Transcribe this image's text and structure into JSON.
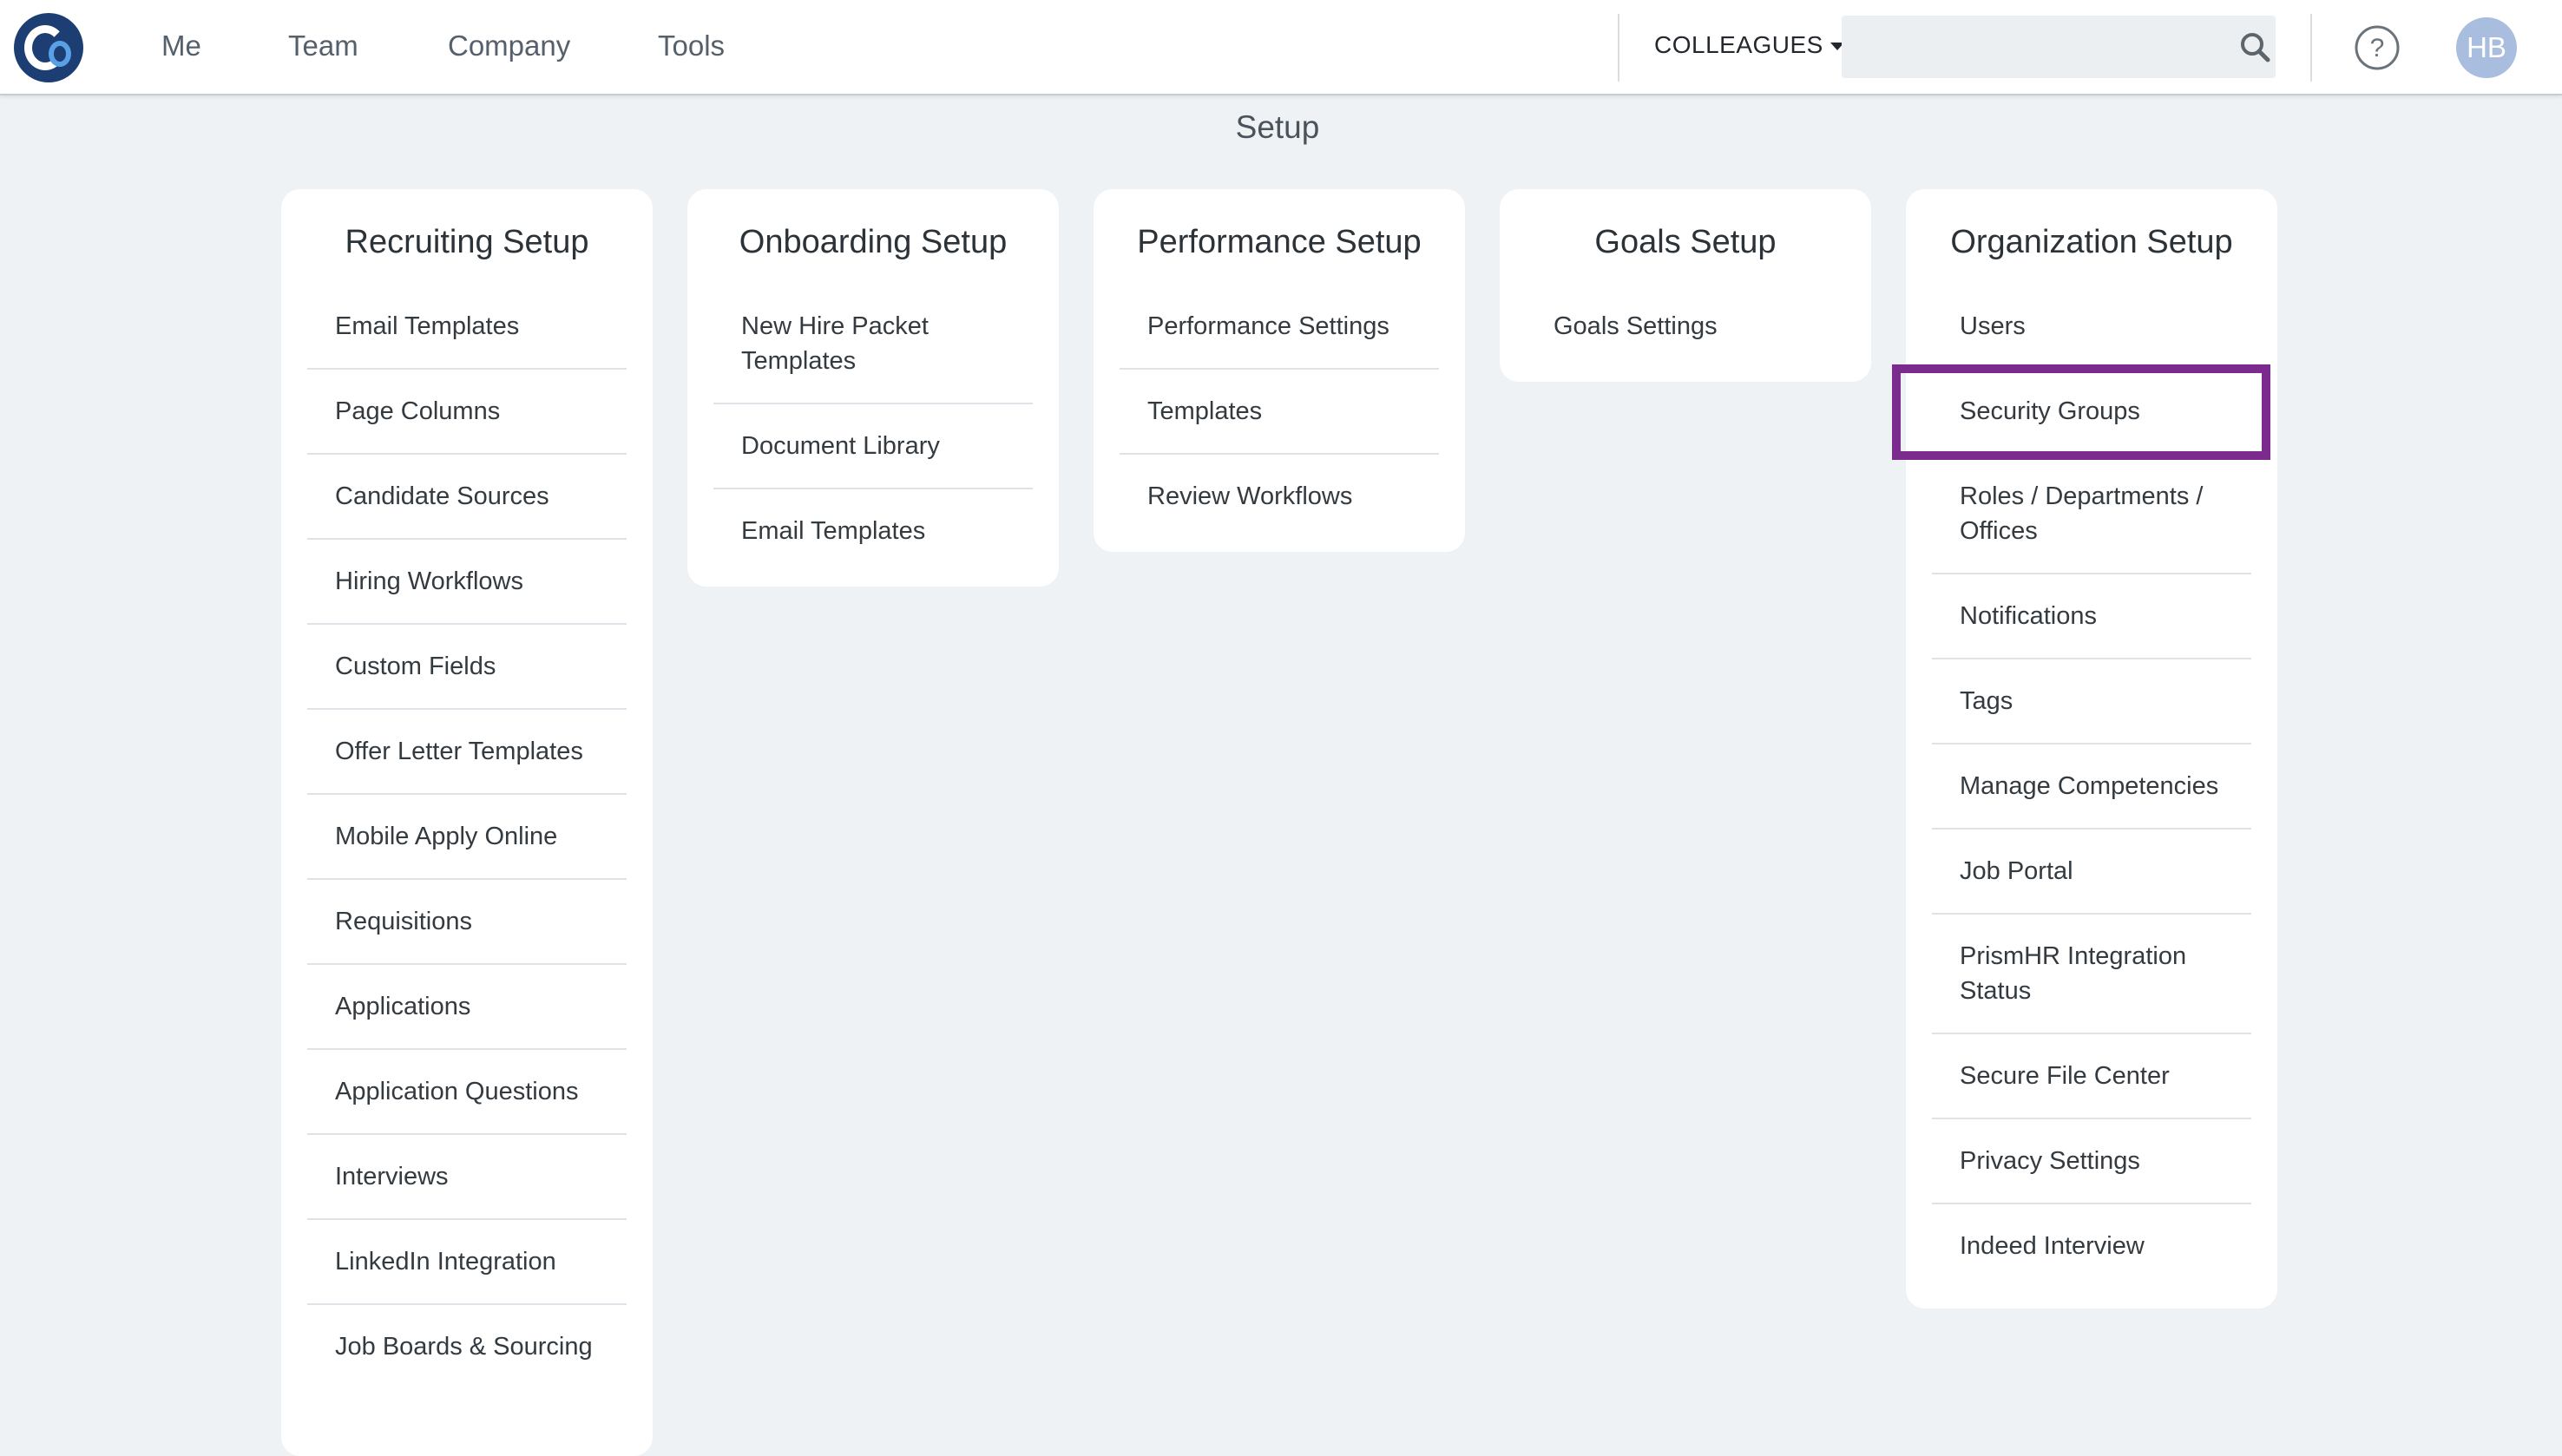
{
  "nav": {
    "items": [
      "Me",
      "Team",
      "Company",
      "Tools"
    ],
    "colleagues_label": "COLLEAGUES",
    "search_placeholder": "",
    "avatar_initials": "HB"
  },
  "icons": {
    "logo": "company-logo",
    "search": "search-icon",
    "help": "help-icon",
    "dropdown": "caret-down-icon"
  },
  "page": {
    "title": "Setup"
  },
  "cards": [
    {
      "title": "Recruiting Setup",
      "items": [
        "Email Templates",
        "Page Columns",
        "Candidate Sources",
        "Hiring Workflows",
        "Custom Fields",
        "Offer Letter Templates",
        "Mobile Apply Online",
        "Requisitions",
        "Applications",
        "Application Questions",
        "Interviews",
        "LinkedIn Integration",
        "Job Boards & Sourcing"
      ]
    },
    {
      "title": "Onboarding Setup",
      "items": [
        "New Hire Packet Templates",
        "Document Library",
        "Email Templates"
      ]
    },
    {
      "title": "Performance Setup",
      "items": [
        "Performance Settings",
        "Templates",
        "Review Workflows"
      ]
    },
    {
      "title": "Goals Setup",
      "items": [
        "Goals Settings"
      ]
    },
    {
      "title": "Organization Setup",
      "items": [
        "Users",
        "Security Groups",
        "Roles / Departments / Offices",
        "Notifications",
        "Tags",
        "Manage Competencies",
        "Job Portal",
        "PrismHR Integration Status",
        "Secure File Center",
        "Privacy Settings",
        "Indeed Interview"
      ]
    }
  ],
  "colors": {
    "background": "#eff2f5",
    "logo": "#1c3e73",
    "highlight": "#7b2a8e",
    "avatar": "#a9bddf"
  }
}
